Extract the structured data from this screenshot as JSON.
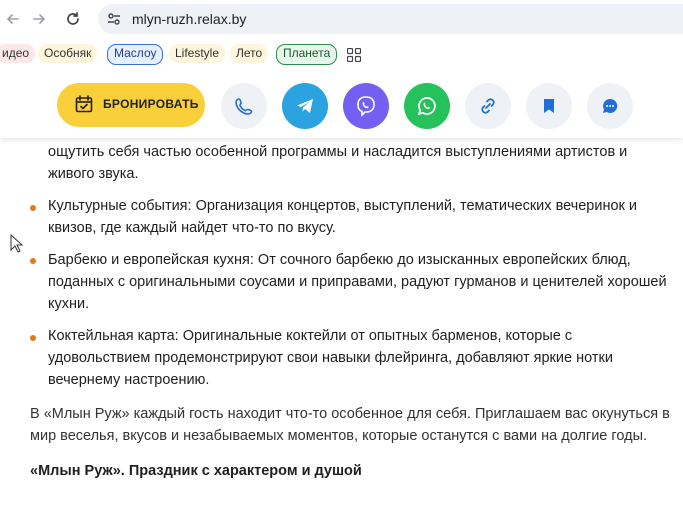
{
  "browser": {
    "url": "mlyn-ruzh.relax.by"
  },
  "tags": [
    {
      "label": "идео"
    },
    {
      "label": "Особняк"
    },
    {
      "label": "Маслоу"
    },
    {
      "label": "Lifestyle"
    },
    {
      "label": "Лето"
    },
    {
      "label": "Планета"
    }
  ],
  "actions": {
    "book_label": "БРОНИРОВАТЬ",
    "colors": {
      "book": "#f9cf3a",
      "telegram": "#2aa3e0",
      "viber": "#7360f2",
      "whatsapp": "#25c15a",
      "neutral": "#eef1f5"
    }
  },
  "content": {
    "top_fragment": "ощутить себя частью особенной программы и насладится выступлениями артистов и живого звука.",
    "bullets": [
      "Культурные события: Организация концертов, выступлений, тематических вечеринок и квизов, где каждый найдет что-то по вкусу.",
      "Барбекю и европейская кухня: От сочного барбекю до изысканных европейских блюд, поданных с оригинальными соусами и приправами, радуют гурманов и ценителей хорошей кухни.",
      "Коктейльная карта: Оригинальные коктейли от опытных барменов, которые с удовольствием продемонстрируют свои навыки флейринга, добавляют яркие нотки вечернему настроению."
    ],
    "paragraph": "В «Млын Руж» каждый гость находит что-то особенное для себя. Приглашаем вас окунуться в мир веселья, вкусов и незабываемых моментов, которые останутся с вами на долгие годы.",
    "tagline": "«Млын Руж». Праздник с характером и душой"
  }
}
